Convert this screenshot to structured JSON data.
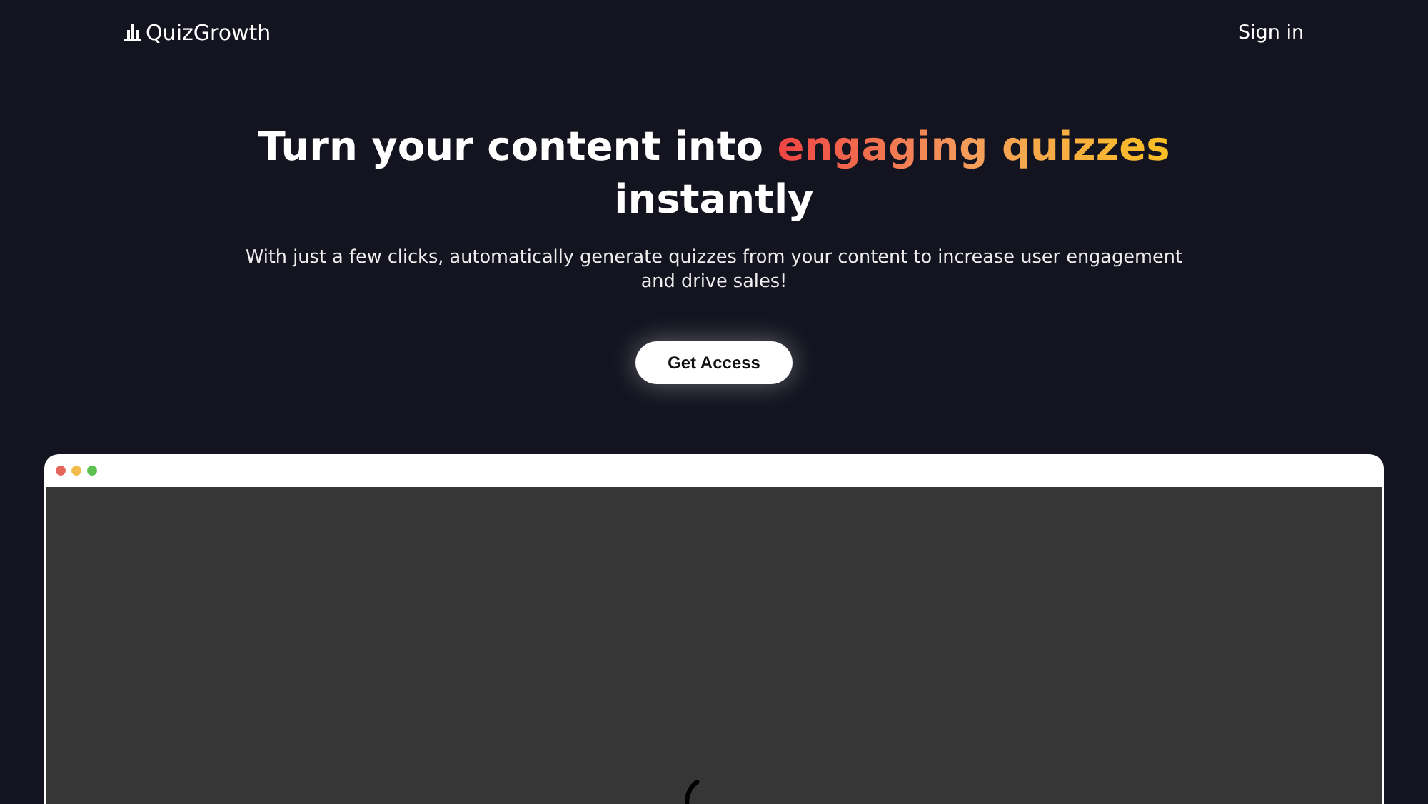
{
  "nav": {
    "brand": "QuizGrowth",
    "sign_in": "Sign in"
  },
  "hero": {
    "title_before": "Turn your content into ",
    "title_highlight": "engaging quizzes",
    "title_after": "instantly",
    "subtitle": "With just a few clicks, automatically generate quizzes from your content to increase user engagement and drive sales!",
    "cta": "Get Access"
  },
  "preview": {
    "window_dots": [
      {
        "color": "#e5675b"
      },
      {
        "color": "#f2bb4a"
      },
      {
        "color": "#5cc04f"
      }
    ]
  }
}
